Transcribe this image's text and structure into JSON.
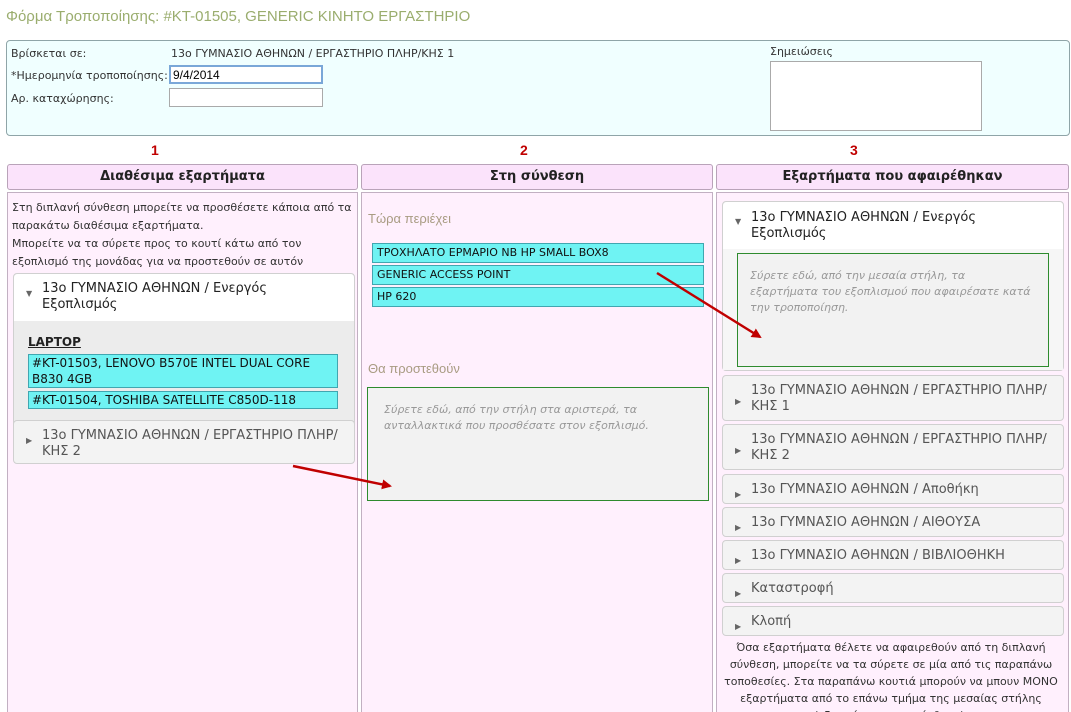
{
  "page_title": "Φόρμα Τροποποίησης: #KT-01505, GENERIC ΚΙΝΗΤΟ ΕΡΓΑΣΤΗΡΙΟ",
  "info": {
    "location_label": "Βρίσκεται σε:",
    "location_value": "13ο ΓΥΜΝΑΣΙΟ ΑΘΗΝΩΝ / ΕΡΓΑΣΤΗΡΙΟ ΠΛΗΡ/ΚΗΣ 1",
    "date_label": "*Ημερομηνία τροποποίησης:",
    "date_value": "9/4/2014",
    "reg_label": "Αρ. καταχώρησης:",
    "reg_value": "",
    "notes_label": "Σημειώσεις",
    "notes_value": ""
  },
  "columns": {
    "col1": {
      "number": "1",
      "title": "Διαθέσιμα εξαρτήματα"
    },
    "col2": {
      "number": "2",
      "title": "Στη σύνθεση"
    },
    "col3": {
      "number": "3",
      "title": "Εξαρτήματα που αφαιρέθηκαν"
    }
  },
  "left": {
    "help_line1": "Στη διπλανή σύνθεση μπορείτε να προσθέσετε κάποια από τα παρακάτω διαθέσιμα εξαρτήματα.",
    "help_line2": "Μπορείτε να τα σύρετε προς το κουτί κάτω από τον εξοπλισμό της μονάδας για να προστεθούν σε αυτόν",
    "acc1_title": "13ο ΓΥΜΝΑΣΙΟ ΑΘΗΝΩΝ / Ενεργός Εξοπλισμός",
    "category": "LAPTOP",
    "parts": [
      "#KT-01503, LENOVO B570E INTEL DUAL CORE B830 4GB",
      "#KT-01504, TOSHIBA SATELLITE C850D-118"
    ],
    "acc2_title": "13ο ΓΥΜΝΑΣΙΟ ΑΘΗΝΩΝ / ΕΡΓΑΣΤΗΡΙΟ ΠΛΗΡ/ΚΗΣ 2"
  },
  "middle": {
    "contains_label": "Τώρα περιέχει",
    "contains_items": [
      "ΤΡΟΧΗΛΑΤΟ ΕΡΜΑΡΙΟ NB HP SMALL BOX8",
      "GENERIC ACCESS POINT",
      "HP 620"
    ],
    "to_add_label": "Θα προστεθούν",
    "drop_hint": "Σύρετε εδώ, από την στήλη στα αριστερά, τα ανταλλακτικά που προσθέσατε στον εξοπλισμό."
  },
  "right": {
    "acc_open_title": "13ο ΓΥΜΝΑΣΙΟ ΑΘΗΝΩΝ / Ενεργός Εξοπλισμός",
    "drop_hint": "Σύρετε εδώ, από την μεσαία στήλη, τα εξαρτήματα του εξοπλισμού που αφαιρέσατε κατά την τροποποίηση.",
    "locations": [
      "13ο ΓΥΜΝΑΣΙΟ ΑΘΗΝΩΝ / ΕΡΓΑΣΤΗΡΙΟ ΠΛΗΡ/ΚΗΣ 1",
      "13ο ΓΥΜΝΑΣΙΟ ΑΘΗΝΩΝ / ΕΡΓΑΣΤΗΡΙΟ ΠΛΗΡ/ΚΗΣ 2",
      "13ο ΓΥΜΝΑΣΙΟ ΑΘΗΝΩΝ / Αποθήκη",
      "13ο ΓΥΜΝΑΣΙΟ ΑΘΗΝΩΝ / ΑΙΘΟΥΣΑ",
      "13ο ΓΥΜΝΑΣΙΟ ΑΘΗΝΩΝ / ΒΙΒΛΙΟΘΗΚΗ",
      "Καταστροφή",
      "Κλοπή"
    ],
    "help": "Όσα εξαρτήματα θέλετε να αφαιρεθούν από τη διπλανή σύνθεση, μπορείτε να τα σύρετε σε μία από τις παραπάνω τοποθεσίες. Στα παραπάνω κουτιά μπορούν να μπουν ΜΟΝΟ εξαρτήματα από το επάνω τμήμα της μεσαίας στήλης (εξαρτήματα στη σύνθεση)."
  },
  "icons": {
    "expanded": "triangle-down-icon",
    "collapsed": "triangle-right-icon",
    "arrow_color": "#c00000"
  }
}
